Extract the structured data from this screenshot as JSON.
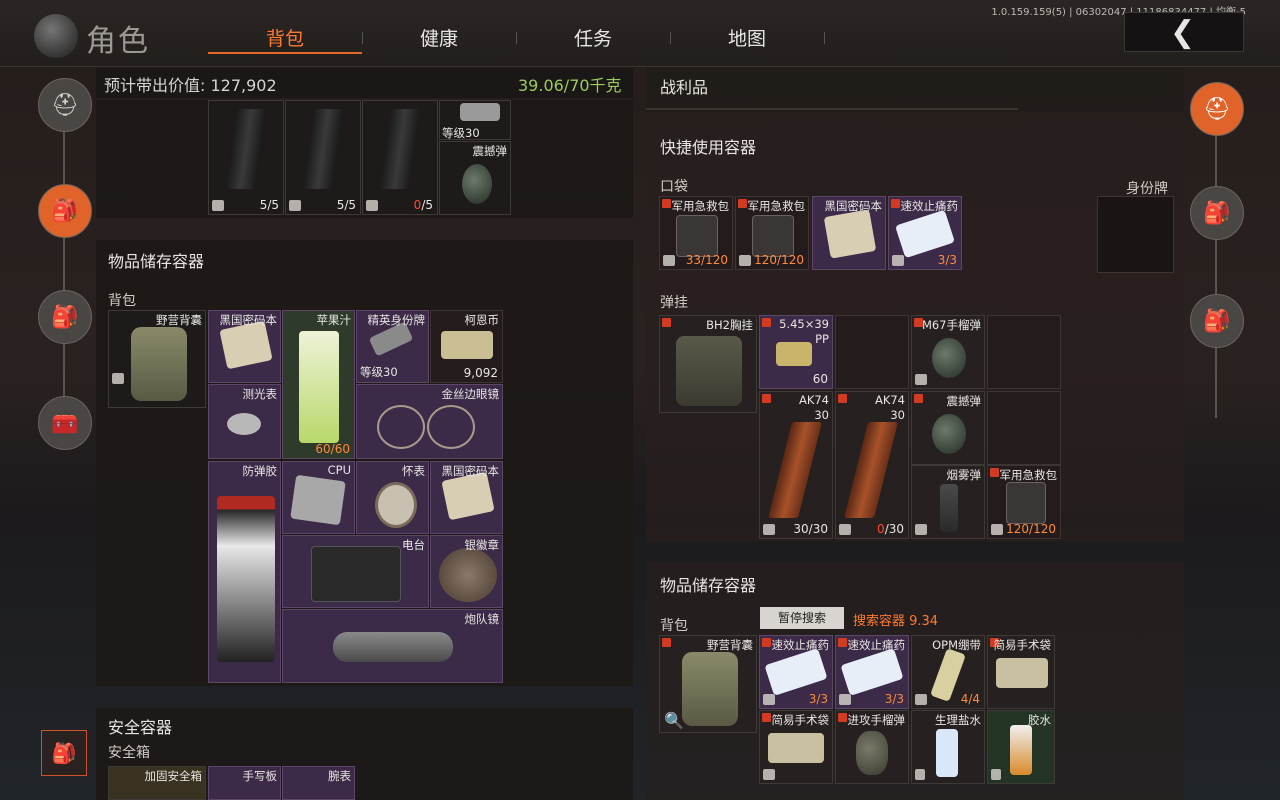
{
  "header": {
    "char_title": "角色",
    "tabs": [
      "背包",
      "健康",
      "任务",
      "地图"
    ],
    "active_tab": 0,
    "version": "1.0.159.159(5) | 06302047 | 11186834477 | 均衡-5"
  },
  "stash": {
    "carry_label": "预计带出价值: 127,902",
    "weight": "39.06/70千克",
    "top_row": [
      {
        "count": "5/5",
        "empty": false
      },
      {
        "count": "5/5",
        "empty": false
      },
      {
        "count_red": "0",
        "count_rest": "/5",
        "empty": true
      },
      {
        "name": "等级30"
      },
      {
        "name": "震撼弹"
      }
    ],
    "storage_title": "物品储存容器",
    "backpack_label": "背包",
    "backpack_name": "野营背囊",
    "items": [
      {
        "name": "黑国密码本"
      },
      {
        "name": "苹果汁",
        "count": "60/60"
      },
      {
        "name": "精英身份牌",
        "sub": "等级30"
      },
      {
        "name": "柯恩币",
        "count": "9,092"
      },
      {
        "name": "测光表"
      },
      {
        "name": "金丝边眼镜"
      },
      {
        "name": "防弹胶"
      },
      {
        "name": "CPU"
      },
      {
        "name": "怀表"
      },
      {
        "name": "黑国密码本"
      },
      {
        "name": "电台"
      },
      {
        "name": "银徽章"
      },
      {
        "name": "炮队镜"
      }
    ],
    "safe_title": "安全容器",
    "safe_label": "安全箱",
    "safe_items": [
      {
        "name": "加固安全箱"
      },
      {
        "name": "手写板"
      },
      {
        "name": "腕表"
      }
    ]
  },
  "loot": {
    "title": "战利品",
    "quick_title": "快捷使用容器",
    "pocket_label": "口袋",
    "id_label": "身份牌",
    "pockets": [
      {
        "name": "军用急救包",
        "count": "33/120"
      },
      {
        "name": "军用急救包",
        "count": "120/120"
      },
      {
        "name": "黑国密码本"
      },
      {
        "name": "速效止痛药",
        "count": "3/3"
      }
    ],
    "rig_label": "弹挂",
    "rig_name": "BH2胸挂",
    "rig_items": [
      {
        "name": "5.45×39",
        "sub": "PP",
        "count": "60"
      },
      {
        "name": "M67手榴弹"
      },
      {
        "name": "AK74",
        "sub": "30",
        "count": "30/30"
      },
      {
        "name": "AK74",
        "sub": "30",
        "count_red": "0",
        "count_rest": "/30"
      },
      {
        "name": "震撼弹"
      },
      {
        "name": "烟雾弹"
      },
      {
        "name": "军用急救包",
        "count": "120/120"
      }
    ],
    "storage_title": "物品储存容器",
    "backpack_label": "背包",
    "pause_label": "暂停搜索",
    "search_label": "搜索容器 9.34",
    "backpack_name": "野营背囊",
    "bag_items": [
      {
        "name": "速效止痛药",
        "count": "3/3"
      },
      {
        "name": "速效止痛药",
        "count": "3/3"
      },
      {
        "name": "OPM绷带",
        "count": "4/4"
      },
      {
        "name": "简易手术袋"
      },
      {
        "name": "简易手术袋"
      },
      {
        "name": "进攻手榴弹"
      },
      {
        "name": "生理盐水"
      },
      {
        "name": "胶水"
      }
    ]
  },
  "colors": {
    "accent": "#e0632a",
    "weight": "#9ccc5a",
    "rare": "#3b2a48",
    "danger": "#ff4b2b"
  }
}
